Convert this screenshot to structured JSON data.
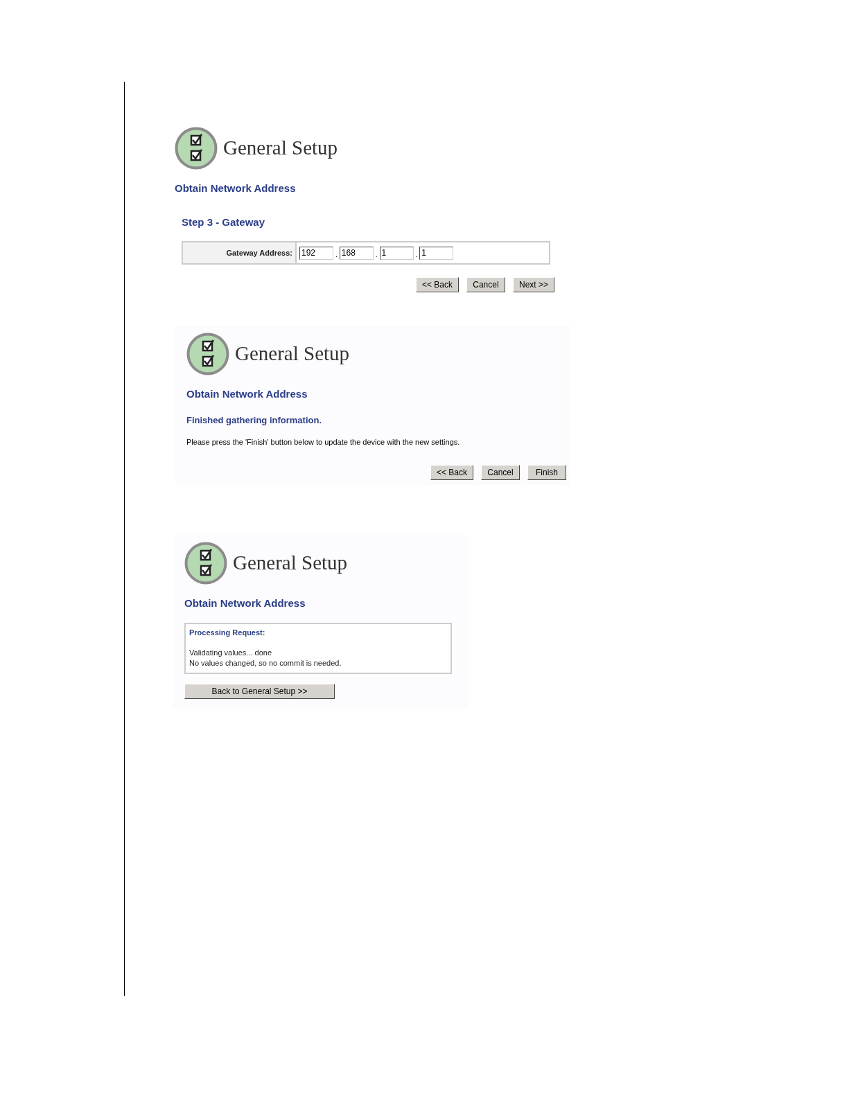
{
  "panels": [
    {
      "kind": "form",
      "title": "General Setup",
      "subtitle": "Obtain Network Address",
      "heading": "Step 3 - Gateway",
      "field_label": "Gateway Address:",
      "octets": [
        "192",
        "168",
        "1",
        "1"
      ],
      "separators": [
        ".",
        ".",
        "."
      ],
      "buttons": [
        "<< Back",
        "Cancel",
        "Next >>"
      ]
    },
    {
      "kind": "message",
      "title": "General Setup",
      "subtitle": "Obtain Network Address",
      "heading": "Finished gathering information.",
      "text": "Please press the 'Finish' button below to update the device with the new settings.",
      "buttons": [
        "<< Back",
        "Cancel",
        "Finish"
      ]
    },
    {
      "kind": "status",
      "title": "General Setup",
      "subtitle": "Obtain Network Address",
      "heading": "Processing Request:",
      "lines": [
        "Validating values... done",
        "No values changed, so no commit is needed."
      ],
      "buttons": [
        "Back to General Setup >>"
      ]
    }
  ]
}
